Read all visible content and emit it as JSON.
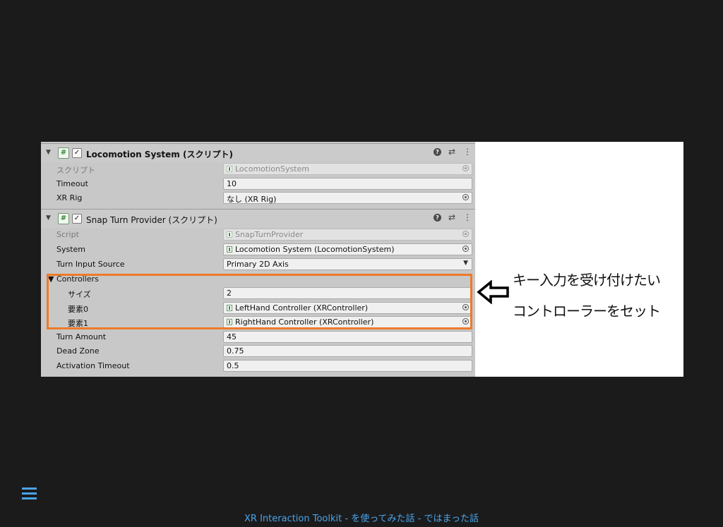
{
  "footer": {
    "title": "XR Interaction Toolkit - を使ってみた話 - ではまった話"
  },
  "annotation": {
    "line1": "キー入力を受け付けたい",
    "line2": "コントローラーをセット",
    "arrow_icon": "left-arrow-outline"
  },
  "colors": {
    "background": "#1b1b1c",
    "accent": "#4aa3e8",
    "highlight": "#ee7a28",
    "inspector_bg": "#c8c8c8"
  },
  "locomotion_component": {
    "title": "Locomotion System (スクリプト)",
    "rows": [
      {
        "label": "スクリプト",
        "value": "LocomotionSystem"
      },
      {
        "label": "Timeout",
        "value": "10"
      },
      {
        "label": "XR Rig",
        "value": "なし (XR Rig)"
      }
    ]
  },
  "snap_component": {
    "title": "Snap Turn Provider (スクリプト)",
    "script": {
      "label": "Script",
      "value": "SnapTurnProvider"
    },
    "system": {
      "label": "System",
      "value": "Locomotion System (LocomotionSystem)"
    },
    "turn_input_source": {
      "label": "Turn Input Source",
      "value": "Primary 2D Axis"
    },
    "controllers": {
      "label": "Controllers",
      "size_label": "サイズ",
      "size_value": "2",
      "elements": [
        {
          "label": "要素0",
          "value": "LeftHand Controller (XRController)"
        },
        {
          "label": "要素1",
          "value": "RightHand Controller (XRController)"
        }
      ]
    },
    "turn_amount": {
      "label": "Turn Amount",
      "value": "45"
    },
    "dead_zone": {
      "label": "Dead Zone",
      "value": "0.75"
    },
    "activation_timeout": {
      "label": "Activation Timeout",
      "value": "0.5"
    }
  }
}
